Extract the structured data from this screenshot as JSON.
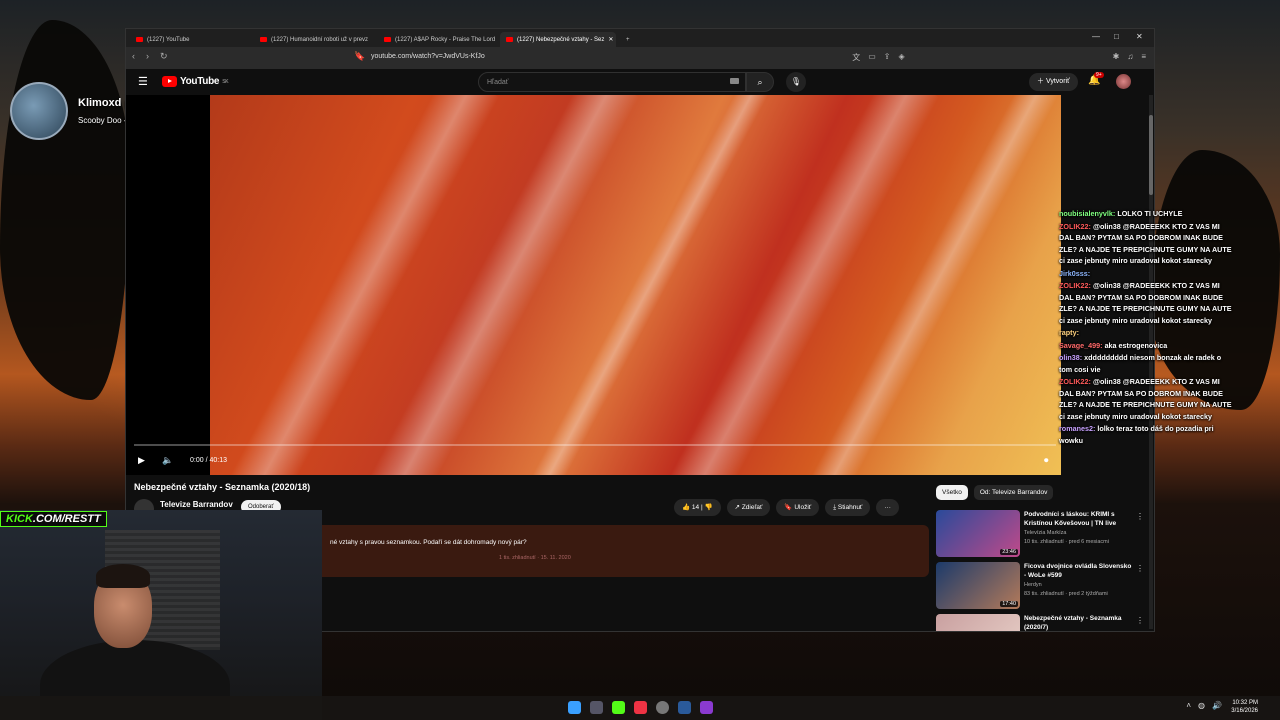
{
  "overlay": {
    "now_playing_title": "Klimoxd played a TTS!",
    "now_playing_sub": "Scooby Doo - Dog | TTS voice Blerp"
  },
  "browser": {
    "tabs": [
      {
        "label": "(1227) YouTube"
      },
      {
        "label": "(1227) Humanoidní roboti už v prevz"
      },
      {
        "label": "(1227) A$AP Rocky - Praise The Lord"
      },
      {
        "label": "(1227) Nebezpečné vztahy - Sez"
      }
    ],
    "url": "youtube.com/watch?v=JwdVUs-KfJo"
  },
  "youtube": {
    "logo": "YouTube",
    "logo_region": "SK",
    "search_placeholder": "Hľadať",
    "create_label": "Vytvoriť",
    "notif_count": "9+",
    "player": {
      "time": "0:00 / 40:13",
      "progress": 0
    },
    "video_title": "Nebezpečné vztahy - Seznamka (2020/18)",
    "channel_name": "Televize Barrandov",
    "subscribe_label": "Odoberať",
    "like_count": "14",
    "share_label": "Zdieľať",
    "save_label": "Uložiť",
    "download_label": "Stiahnuť",
    "description": "né vztahy s pravou seznamkou. Podaří se dát dohromady nový pár?",
    "description_meta": "1 tis. zhliadnutí · 15. 11. 2020",
    "chips": [
      "Všetko",
      "Od: Televize Barrandov"
    ],
    "recommendations": [
      {
        "title": "Podvodníci s láskou: KRIMI s Kristínou Kővešovou | TN live",
        "channel": "Televízia Markíza",
        "meta": "10 tis. zhliadnutí · pred 6 mesiacmi",
        "duration": "23:46"
      },
      {
        "title": "Ficova dvojnice ovládla Slovensko - WoLe #599",
        "channel": "Herdyn",
        "meta": "83 tis. zhliadnutí · pred 2 týždňami",
        "duration": "17:40"
      },
      {
        "title": "Nebezpečné vztahy - Seznamka (2020/7)",
        "channel": "",
        "meta": "",
        "duration": ""
      }
    ]
  },
  "chat": [
    {
      "user": "noubisialenyvlk:",
      "color": "#7fff7f",
      "text": "LOLKO TI UCHYLE"
    },
    {
      "user": "ZOLIK22:",
      "color": "#ff5a5a",
      "text": "@olin38 @RADEEEKK KTO Z VAS MI DAL BAN? PYTAM SA PO DOBROM INAK BUDE ZLE? A NAJDE TE PREPICHNUTE GUMY NA AUTE ci zase jebnuty miro uradoval kokot starecky"
    },
    {
      "user": "Jirk0sss:",
      "color": "#8fb8ff",
      "text": ""
    },
    {
      "user": "ZOLIK22:",
      "color": "#ff5a5a",
      "text": "@olin38 @RADEEEKK KTO Z VAS MI DAL BAN? PYTAM SA PO DOBROM INAK BUDE ZLE? A NAJDE TE PREPICHNUTE GUMY NA AUTE ci zase jebnuty miro uradoval kokot starecky"
    },
    {
      "user": "rapty:",
      "color": "#ffd27f",
      "text": ""
    },
    {
      "user": "Savage_499:",
      "color": "#ff6a6a",
      "text": "aka estrogenovica"
    },
    {
      "user": "olin38:",
      "color": "#c8a2ff",
      "text": "xddddddddd niesom bonzak ale radek o tom cosi vie"
    },
    {
      "user": "ZOLIK22:",
      "color": "#ff5a5a",
      "text": "@olin38 @RADEEEKK KTO Z VAS MI DAL BAN? PYTAM SA PO DOBROM INAK BUDE ZLE? A NAJDE TE PREPICHNUTE GUMY NA AUTE ci zase jebnuty miro uradoval kokot starecky"
    },
    {
      "user": "romanes2:",
      "color": "#c8a2ff",
      "text": "lolko teraz toto dáš do pozadia pri wowku"
    }
  ],
  "webcam": {
    "kick_prefix": "KICK",
    "kick_url": ".COM/RESTT"
  },
  "taskbar": {
    "time": "10:32 PM",
    "date": "3/16/2026"
  }
}
